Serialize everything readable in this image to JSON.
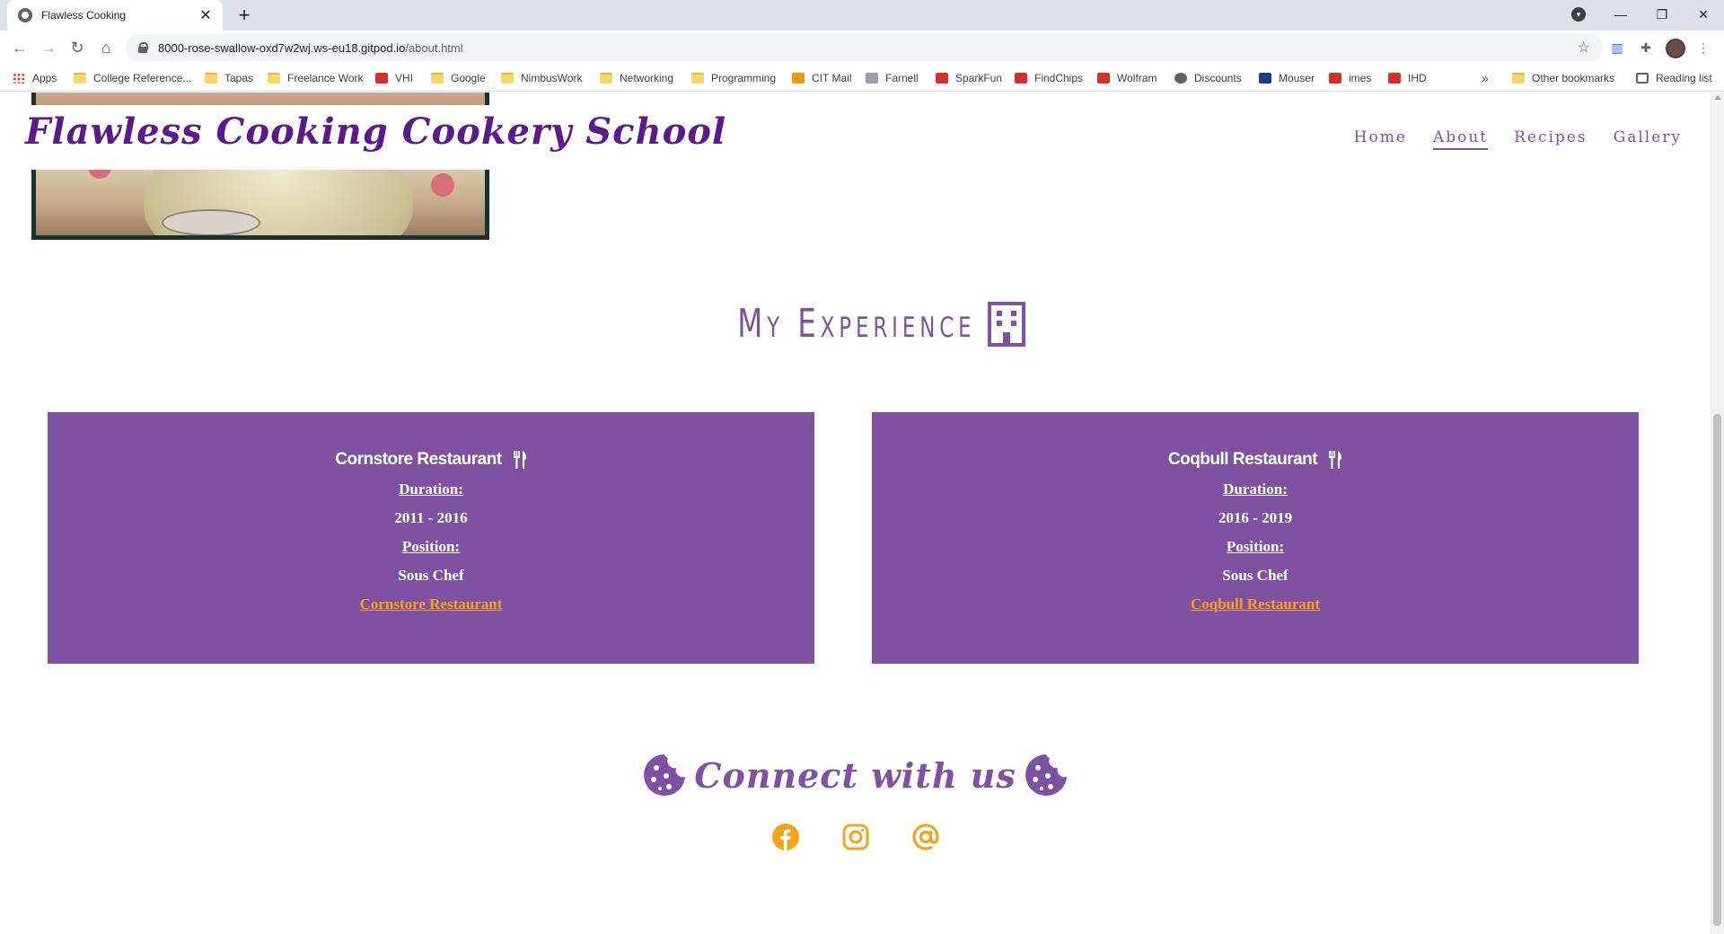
{
  "browser": {
    "tab_title": "Flawless Cooking",
    "url_host": "8000-rose-swallow-oxd7w2wj.ws-eu18.gitpod.io",
    "url_path": "/about.html",
    "bookmarks": [
      "Apps",
      "College Reference...",
      "Tapas",
      "Freelance Work",
      "VHI",
      "Google",
      "NimbusWork",
      "Networking",
      "Programming",
      "CIT Mail",
      "Farnell",
      "SparkFun",
      "FindChips",
      "Wolfram",
      "Discounts",
      "Mouser",
      "imes",
      "IHD"
    ],
    "overflow_label": "»",
    "other_bookmarks": "Other bookmarks",
    "reading_list": "Reading list"
  },
  "site": {
    "brand": "Flawless Cooking Cookery School",
    "nav": [
      "Home",
      "About",
      "Recipes",
      "Gallery"
    ],
    "active_nav": "About"
  },
  "experience": {
    "title": "My Experience",
    "cards": [
      {
        "restaurant": "Cornstore Restaurant",
        "duration_label": "Duration:",
        "duration": "2011 - 2016",
        "position_label": "Position:",
        "position": "Sous Chef",
        "link_text": "Cornstore Restaurant"
      },
      {
        "restaurant": "Coqbull Restaurant",
        "duration_label": "Duration:",
        "duration": "2016 - 2019",
        "position_label": "Position:",
        "position": "Sous Chef",
        "link_text": "Coqbull Restaurant"
      }
    ]
  },
  "connect": {
    "title": "Connect with us",
    "social": [
      "facebook-icon",
      "instagram-icon",
      "email-icon"
    ]
  },
  "colors": {
    "brand_purple": "#7e52a0",
    "accent_orange": "#f6a21a"
  }
}
